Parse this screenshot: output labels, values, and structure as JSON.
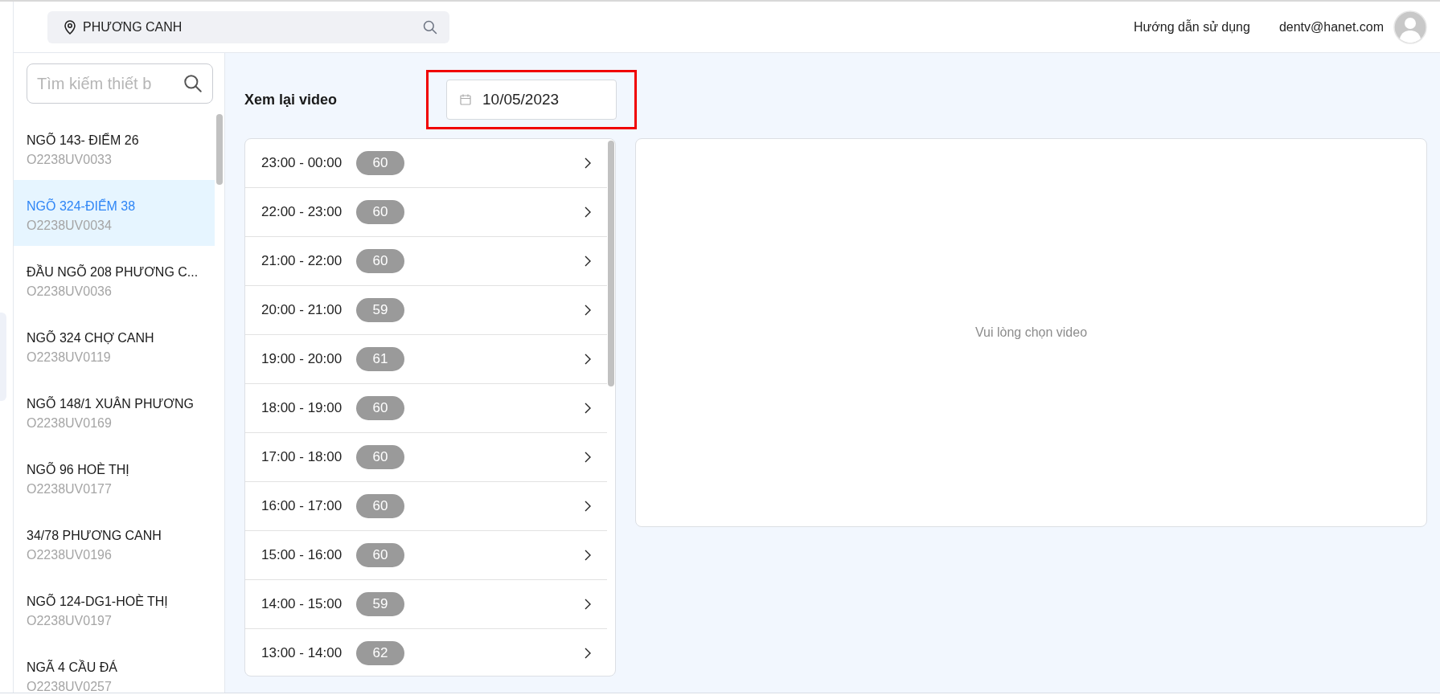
{
  "header": {
    "location": "PHƯƠNG CANH",
    "help_link": "Hướng dẫn sử dụng",
    "user_email": "dentv@hanet.com"
  },
  "sidebar": {
    "search": {
      "placeholder": "Tìm kiếm thiết b"
    },
    "devices": [
      {
        "name": "NGÕ 143- ĐIỂM 26",
        "code": "O2238UV0033",
        "selected": false
      },
      {
        "name": "NGÕ 324-ĐIỂM 38",
        "code": "O2238UV0034",
        "selected": true
      },
      {
        "name": "ĐẦU NGÕ 208 PHƯƠNG C...",
        "code": "O2238UV0036",
        "selected": false
      },
      {
        "name": "NGÕ 324 CHỢ CANH",
        "code": "O2238UV0119",
        "selected": false
      },
      {
        "name": "NGÕ 148/1 XUÂN PHƯƠNG",
        "code": "O2238UV0169",
        "selected": false
      },
      {
        "name": "NGÕ 96 HOÈ THỊ",
        "code": "O2238UV0177",
        "selected": false
      },
      {
        "name": "34/78 PHƯƠNG CANH",
        "code": "O2238UV0196",
        "selected": false
      },
      {
        "name": "NGÕ 124-DG1-HOÈ THỊ",
        "code": "O2238UV0197",
        "selected": false
      },
      {
        "name": "NGÃ 4 CẦU ĐÁ",
        "code": "O2238UV0257",
        "selected": false
      }
    ]
  },
  "main": {
    "title": "Xem lại video",
    "date_picker": {
      "value": "10/05/2023",
      "highlighted": true
    },
    "hours": [
      {
        "range": "23:00 - 00:00",
        "count": "60"
      },
      {
        "range": "22:00 - 23:00",
        "count": "60"
      },
      {
        "range": "21:00 - 22:00",
        "count": "60"
      },
      {
        "range": "20:00 - 21:00",
        "count": "59"
      },
      {
        "range": "19:00 - 20:00",
        "count": "61"
      },
      {
        "range": "18:00 - 19:00",
        "count": "60"
      },
      {
        "range": "17:00 - 18:00",
        "count": "60"
      },
      {
        "range": "16:00 - 17:00",
        "count": "60"
      },
      {
        "range": "15:00 - 16:00",
        "count": "60"
      },
      {
        "range": "14:00 - 15:00",
        "count": "59"
      },
      {
        "range": "13:00 - 14:00",
        "count": "62"
      }
    ],
    "video_placeholder": "Vui lòng chọn video"
  }
}
